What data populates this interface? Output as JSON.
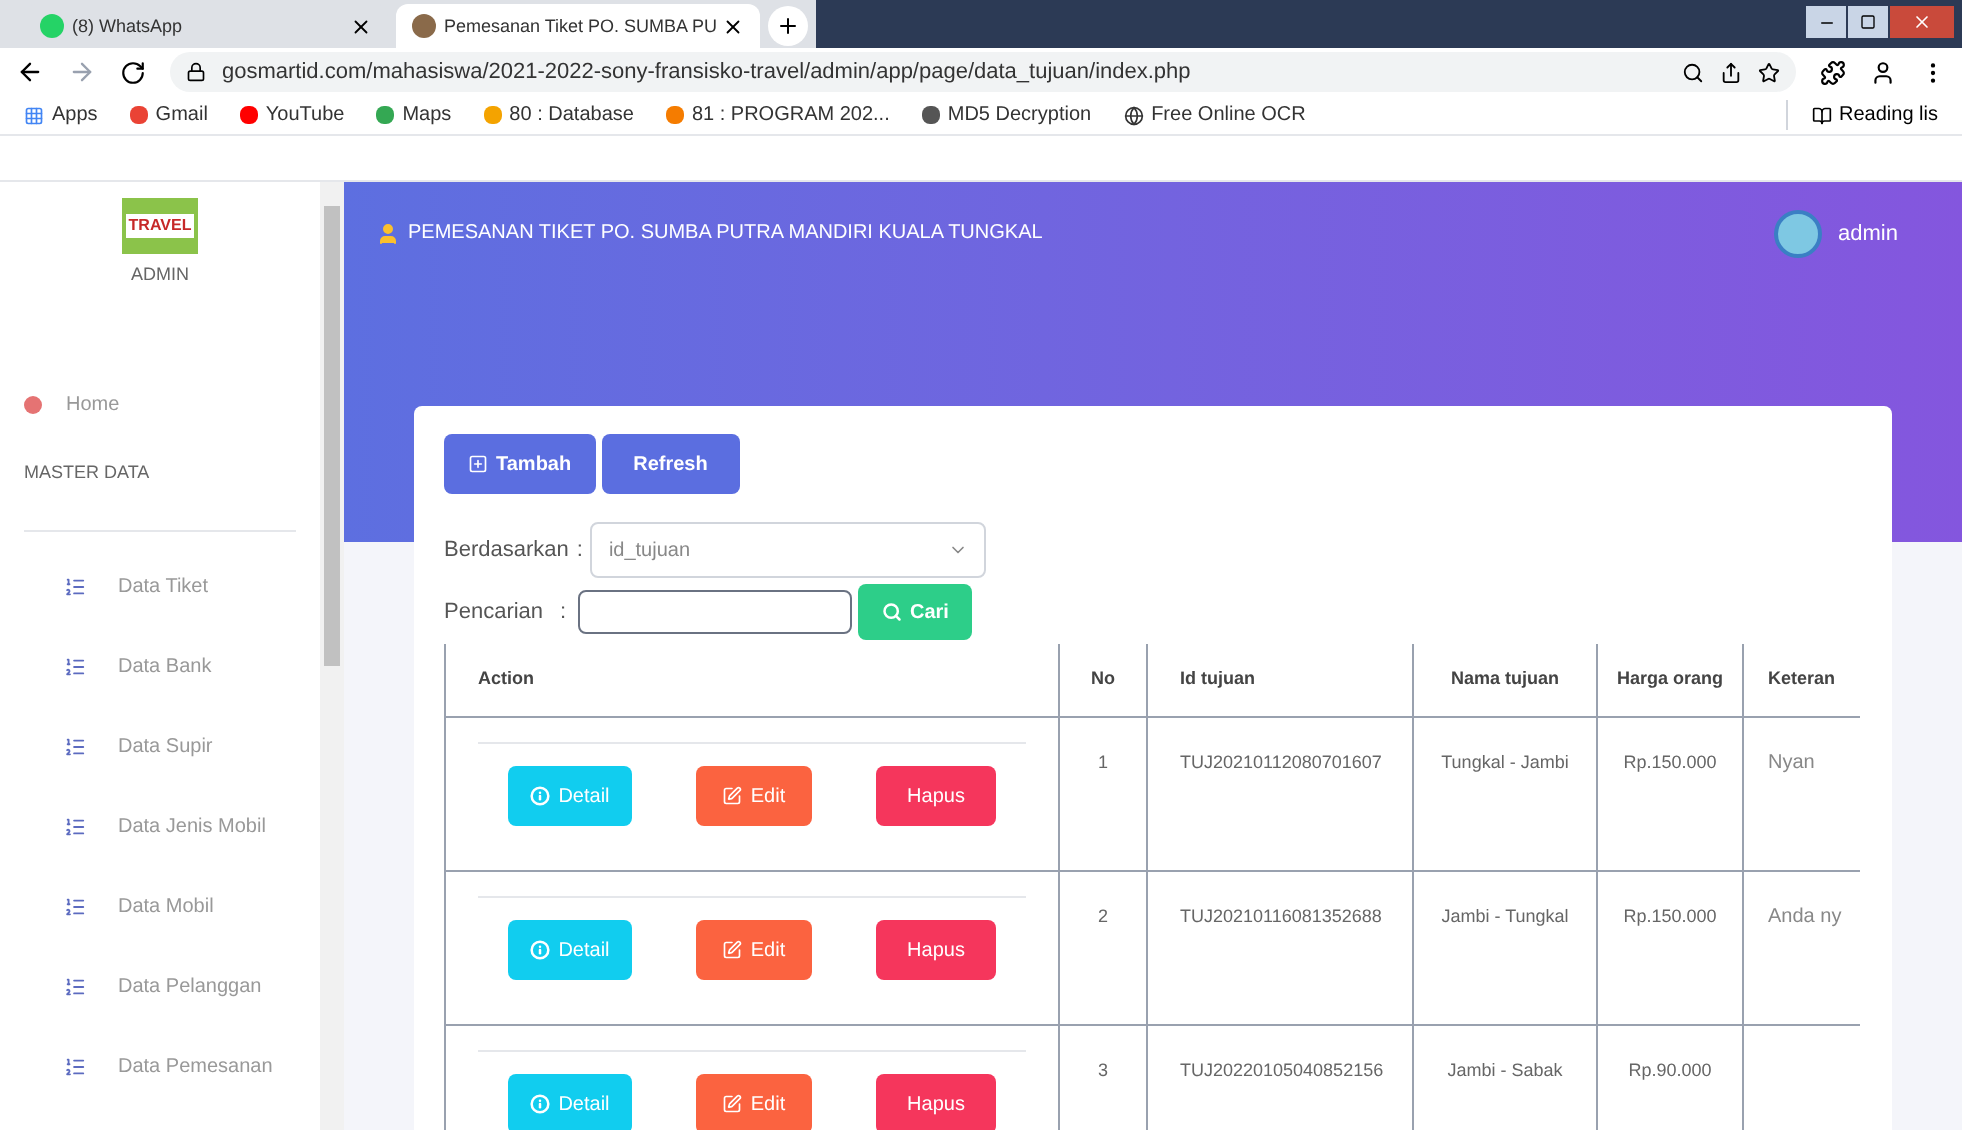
{
  "browser": {
    "tabs": [
      {
        "title": "(8) WhatsApp",
        "selected": false
      },
      {
        "title": "Pemesanan Tiket PO. SUMBA PU",
        "selected": true
      }
    ],
    "address": "gosmartid.com/mahasiswa/2021-2022-sony-fransisko-travel/admin/app/page/data_tujuan/index.php",
    "bookmarks": [
      "Apps",
      "Gmail",
      "YouTube",
      "Maps",
      "80 : Database",
      "81 : PROGRAM 202...",
      "MD5 Decryption",
      "Free Online OCR"
    ],
    "reading_list": "Reading lis"
  },
  "sidebar": {
    "logo_text": "TRAVEL",
    "role": "ADMIN",
    "home": "Home",
    "section": "MASTER DATA",
    "items": [
      "Data Tiket",
      "Data Bank",
      "Data Supir",
      "Data Jenis Mobil",
      "Data Mobil",
      "Data Pelanggan",
      "Data Pemesanan"
    ]
  },
  "header": {
    "title": "PEMESANAN TIKET PO. SUMBA PUTRA MANDIRI KUALA TUNGKAL",
    "user": "admin"
  },
  "toolbar": {
    "add": "Tambah",
    "refresh": "Refresh"
  },
  "filter": {
    "label": "Berdasarkan",
    "separator": ":",
    "value": "id_tujuan"
  },
  "search": {
    "label": "Pencarian",
    "separator": ":",
    "button": "Cari"
  },
  "table": {
    "columns": [
      "Action",
      "No",
      "Id tujuan",
      "Nama tujuan",
      "Harga orang",
      "Keteran"
    ],
    "rows": [
      {
        "detail": "Detail",
        "edit": "Edit",
        "delete": "Hapus",
        "no": "1",
        "id": "TUJ20210112080701607",
        "name": "Tungkal - Jambi",
        "price": "Rp.150.000",
        "note": "Nyan"
      },
      {
        "detail": "Detail",
        "edit": "Edit",
        "delete": "Hapus",
        "no": "2",
        "id": "TUJ20210116081352688",
        "name": "Jambi - Tungkal",
        "price": "Rp.150.000",
        "note": "Anda ny"
      },
      {
        "detail": "Detail",
        "edit": "Edit",
        "delete": "Hapus",
        "no": "3",
        "id": "TUJ20220105040852156",
        "name": "Jambi - Sabak",
        "price": "Rp.90.000",
        "note": ""
      }
    ]
  }
}
